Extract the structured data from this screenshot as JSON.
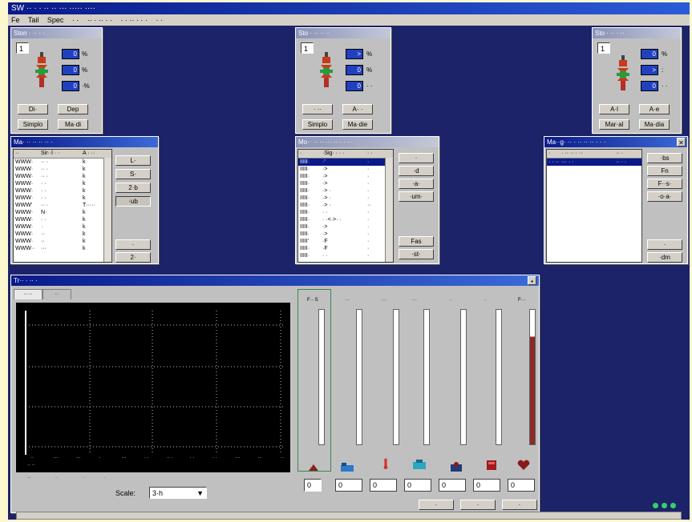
{
  "app": {
    "title": "SW ·· · · ·· ·· ··· ····· ····",
    "menu": [
      "Fe",
      "Tail",
      "Spec",
      "· ·",
      "·· · ·· · ·",
      "· · ·· · · ·",
      "· ·"
    ]
  },
  "station_left": {
    "title": "Ston · ·· · ·",
    "num": "1",
    "values": [
      {
        "v": "0",
        "u": "%"
      },
      {
        "v": "0",
        "u": "%"
      },
      {
        "v": "0",
        "u": "·%"
      }
    ],
    "buttons": [
      "Di·",
      "Dep",
      "Simplo",
      "Ma·di"
    ]
  },
  "station_mid": {
    "title": "Sto · ·· ·· ··",
    "num": "1",
    "values": [
      {
        "v": ">",
        "u": "%"
      },
      {
        "v": "0",
        "u": "%"
      },
      {
        "v": "0",
        "u": "· ·"
      }
    ],
    "buttons": [
      "· ··",
      "A· ·",
      "Simplo",
      "Ma·die"
    ]
  },
  "station_right": {
    "title": "Sto · ·· · ··",
    "num": "1",
    "values": [
      {
        "v": "0",
        "u": "%"
      },
      {
        "v": ">",
        "u": ":"
      },
      {
        "v": "0",
        "u": "· ·"
      }
    ],
    "buttons": [
      "A·l",
      "A·e",
      "Mar·al",
      "Ma·dia"
    ]
  },
  "list_left": {
    "title": "Ma· ·· ·· ·· ·· ·",
    "headers": [
      "··",
      "Sir··l · ·",
      "A · ··"
    ],
    "rows": [
      [
        "WWW·",
        "·· ·",
        "k"
      ],
      [
        "WWW·",
        "·· ·",
        "k"
      ],
      [
        "WWW·",
        "·· ·",
        "k"
      ],
      [
        "WWW·",
        "· ·",
        "k"
      ],
      [
        "WWW·",
        "· ·",
        "k"
      ],
      [
        "WWW·",
        "· ·",
        "k"
      ],
      [
        "WWW'",
        "·· ·",
        "T·····"
      ],
      [
        "WWW· ",
        "N·",
        "k"
      ],
      [
        "WWW· ",
        "· ·",
        "k"
      ],
      [
        "WWW· ",
        "·",
        "k"
      ],
      [
        "WWW· ",
        "··",
        "k"
      ],
      [
        "WWW·",
        "··",
        "k"
      ],
      [
        "WWW··",
        "···",
        "k"
      ]
    ],
    "buttons": [
      "L·",
      "S·",
      "2·b",
      "·ub",
      "·",
      "2·"
    ]
  },
  "list_mid": {
    "title": "Mo·· ·· ·· ··· ·· · · ··",
    "headers": [
      "·",
      "·Sig· · · ·",
      "· ·"
    ],
    "rows": [
      [
        "IIIII·",
        "·'",
        "·"
      ],
      [
        "IIIII·",
        "·>",
        "·"
      ],
      [
        "IIIII·",
        "·>",
        "·"
      ],
      [
        "IIIII·",
        "·>",
        "·"
      ],
      [
        "IIIII·",
        "·> ·",
        "·"
      ],
      [
        "IIIII·",
        "·> ·",
        "·"
      ],
      [
        "IIIII·",
        "·> ·",
        "··"
      ],
      [
        "IIIII·",
        "· ·",
        "·"
      ],
      [
        "IIIII·",
        "· ·<·>· ·",
        "·"
      ],
      [
        "IIIII·",
        "·>",
        "·"
      ],
      [
        "IIIII·",
        "·>",
        "·"
      ],
      [
        "IIIII'",
        "·F",
        "·"
      ],
      [
        "IIIII·",
        "·F",
        "·"
      ],
      [
        "IIIII·",
        "· ·",
        " ·"
      ]
    ],
    "buttons": [
      "·",
      "·d",
      "·a·",
      "·um·",
      "Fas",
      "·st·"
    ]
  },
  "list_right": {
    "title": "Ma··g· ·· · ·· ·· ·· · · ·",
    "headers": [
      "·",
      "· ·· ·· · ··",
      "·· ·"
    ],
    "rows": [
      [
        "· · ··",
        "··· · ·",
        "·· · ·"
      ]
    ],
    "buttons": [
      "·bs",
      "Fn",
      "F··s·",
      "·o·a·",
      "·",
      "·dm"
    ]
  },
  "trend": {
    "title": "Tr·· · ·· ·",
    "tabs": [
      "·····",
      "··"
    ],
    "x_ticks": [
      "··",
      "···",
      "···",
      "·",
      "···",
      "· ·",
      "·· ·",
      "· ·",
      "· ·",
      "···",
      "··",
      "··"
    ],
    "x_sub": "·· ··",
    "under": [
      "··",
      "·",
      "·",
      "·"
    ],
    "scale_label": "Scale:",
    "scale_value": "3·h",
    "buttons": [
      "·",
      "·",
      "·"
    ]
  },
  "meters": {
    "headers": [
      "F···S",
      "···",
      "···",
      "···",
      "··",
      "·",
      "F···"
    ],
    "readouts": [
      "0",
      "0",
      "0",
      "0",
      "0",
      "0",
      "0"
    ],
    "spin_value": "0"
  },
  "status_lights": [
    "#34d06a",
    "#34d06a",
    "#34d06a"
  ]
}
